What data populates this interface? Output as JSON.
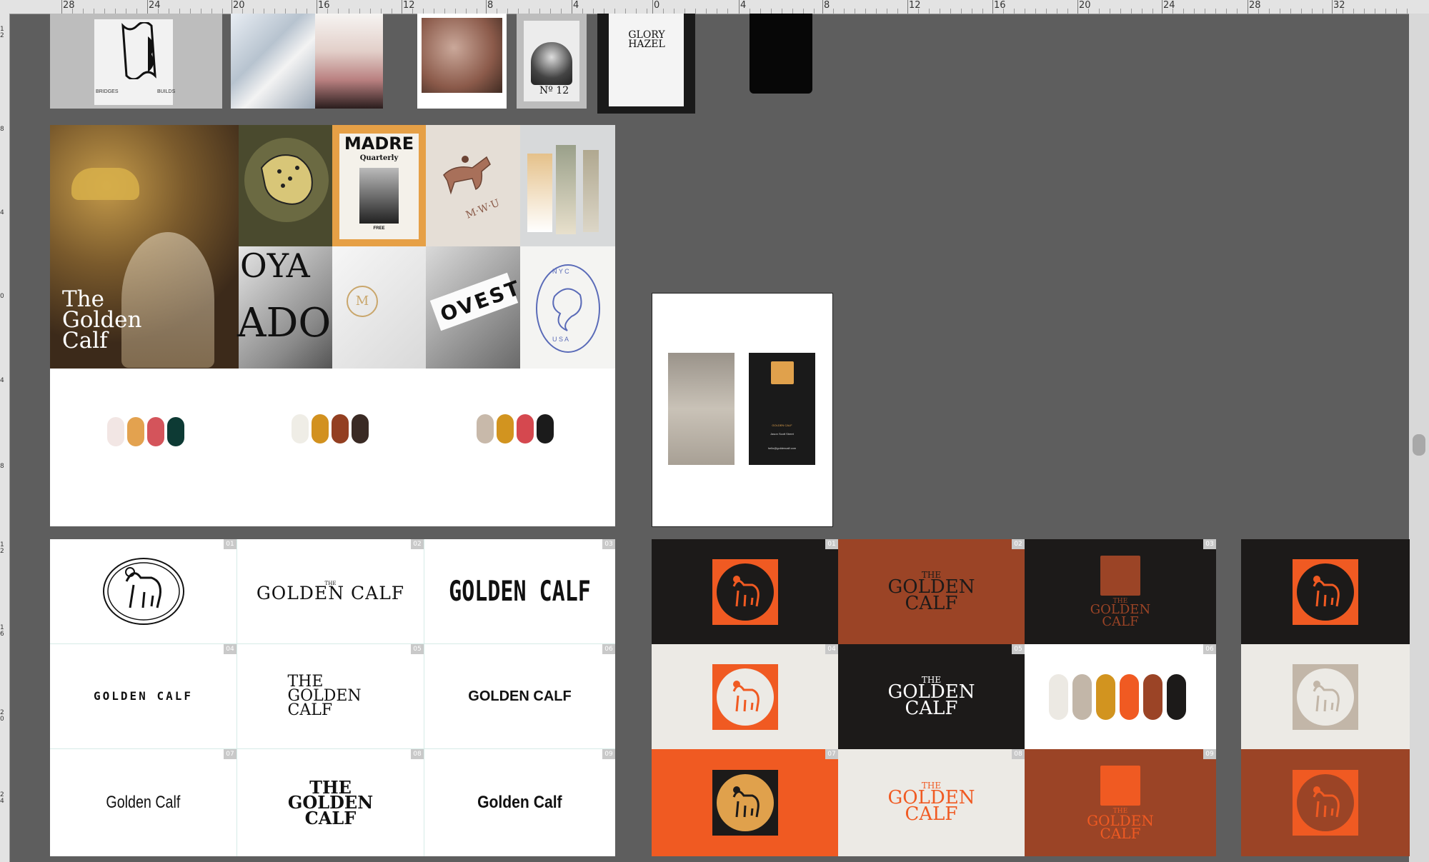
{
  "ruler": {
    "top_labels": [
      "28",
      "24",
      "20",
      "16",
      "12",
      "8",
      "4",
      "0",
      "4",
      "8",
      "12",
      "16",
      "20",
      "24",
      "28",
      "32"
    ],
    "left_labels": [
      "1 2",
      "8",
      "4",
      "0",
      "4",
      "8",
      "1 2",
      "1 6",
      "2 0",
      "2 4"
    ]
  },
  "moodboard": {
    "hero_title_line1": "The",
    "hero_title_line2": "Golden",
    "hero_title_line3": "Calf",
    "madre_title": "MADRE",
    "madre_subtitle": "Quarterly",
    "madre_free": "FREE",
    "mwu_text": "M·W·U",
    "oya_text": "OYA",
    "adop_text": "ADOP",
    "ovest_text": "OVEST",
    "nyc_text": "N Y C",
    "usa_text": "U S A",
    "glory_text": "GLORY HAZEL",
    "no12_text": "Nº 12",
    "bridges_text": "BRIDGES",
    "builds_text": "BUILDS"
  },
  "palettes": [
    {
      "colors": [
        "#f2e6e4",
        "#e3a24f",
        "#d4545b",
        "#0d3a34"
      ]
    },
    {
      "colors": [
        "#efede6",
        "#d2911f",
        "#933f21",
        "#3a2a24"
      ]
    },
    {
      "colors": [
        "#c8b9aa",
        "#d2941f",
        "#d5484f",
        "#1b1b1b"
      ]
    }
  ],
  "business_card": {
    "name": "GOLDEN CALF",
    "address": "Jason Scott Street",
    "email": "hello@goldencalf.com"
  },
  "logo_grid": {
    "numbers": [
      "01",
      "02",
      "03",
      "04",
      "05",
      "06",
      "07",
      "08",
      "09"
    ],
    "cell2_small": "THE",
    "cell2_main": "GOLDEN CALF",
    "cell3": "GOLDEN CALF",
    "cell4": "GOLDEN CALF",
    "cell5_l1": "THE",
    "cell5_l2": "GOLDEN",
    "cell5_l3": "CALF",
    "cell6": "GOLDEN CALF",
    "cell7": "Golden Calf",
    "cell8_l1": "THE",
    "cell8_l2": "GOLDEN",
    "cell8_l3": "CALF",
    "cell9": "Golden Calf"
  },
  "color_grid": {
    "numbers": [
      "01",
      "02",
      "03",
      "04",
      "05",
      "06",
      "07",
      "08",
      "09"
    ],
    "the": "THE",
    "golden": "GOLDEN",
    "calf": "CALF",
    "swatches": [
      "#ece9e3",
      "#c2b6a8",
      "#d2941f",
      "#f05a22",
      "#9b4426",
      "#1c1a19"
    ]
  },
  "colors": {
    "orange": "#f05a22",
    "rust": "#9b4426",
    "dark": "#1c1a19",
    "cream": "#eceae5",
    "gold": "#e0a14c",
    "canvas": "#5e5e5e"
  }
}
